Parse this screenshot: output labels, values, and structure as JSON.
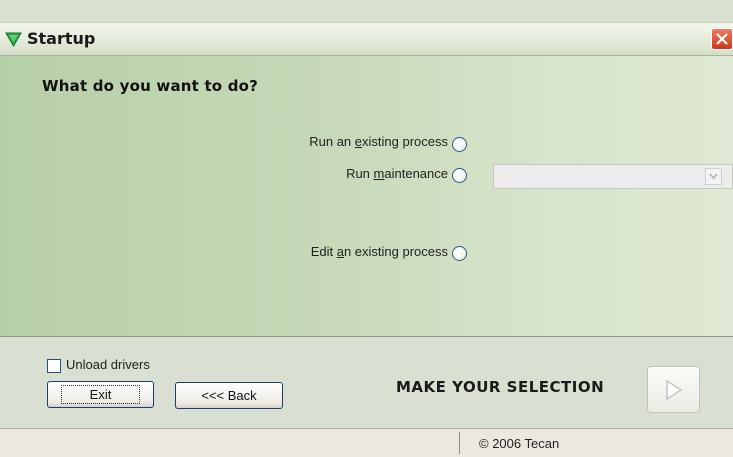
{
  "window": {
    "title": "Startup",
    "close_icon": "close-icon",
    "title_icon": "green-triangle-icon"
  },
  "main": {
    "question": "What do you want to do?",
    "options": [
      {
        "pre": "Run an ",
        "accel": "e",
        "post": "xisting process",
        "selected": false
      },
      {
        "pre": "Run ",
        "accel": "m",
        "post": "aintenance",
        "selected": false
      },
      {
        "pre": "Edit ",
        "accel": "a",
        "post": "n existing process",
        "selected": false
      }
    ],
    "maintenance_select": {
      "value": "",
      "enabled": false
    }
  },
  "bottom": {
    "unload_drivers_label": "Unload drivers",
    "unload_drivers_checked": false,
    "exit_label": "Exit",
    "back_label": "<<< Back",
    "selection_prompt": "MAKE YOUR SELECTION",
    "next_icon": "play-arrow-icon"
  },
  "status": {
    "copyright": "© 2006 Tecan"
  },
  "colors": {
    "panel_green": "#c7d9b9",
    "button_border": "#1c3d73",
    "radio_border": "#2d5a8a",
    "close_red": "#c8391d"
  }
}
